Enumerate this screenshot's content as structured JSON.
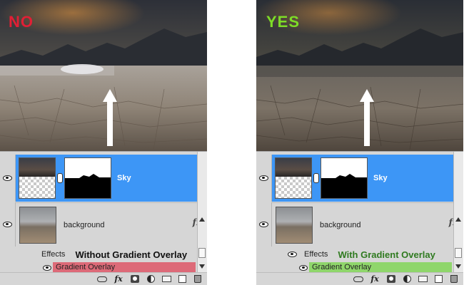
{
  "panels": [
    {
      "verdict": "NO",
      "layers": {
        "sky_layer": "Sky",
        "background_layer": "background",
        "effects_label": "Effects",
        "annotation": "Without Gradient Overlay",
        "effect_item": "Gradient Overlay",
        "fx_badge": "fx"
      },
      "effect_bar_color": "#dd6a78",
      "verdict_color": "#e11f35"
    },
    {
      "verdict": "YES",
      "layers": {
        "sky_layer": "Sky",
        "background_layer": "background",
        "effects_label": "Effects",
        "annotation": "With Gradient Overlay",
        "effect_item": "Gradient Overlay",
        "fx_badge": "fx"
      },
      "effect_bar_color": "#8fd66b",
      "verdict_color": "#7ddc27"
    }
  ],
  "toolbar": {
    "icons": [
      "link-icon",
      "fx-icon",
      "mask-icon",
      "adjustment-icon",
      "folder-icon",
      "new-layer-icon",
      "trash-icon"
    ],
    "fx_label": "fx"
  },
  "colors": {
    "selected_layer": "#3d96f6",
    "panel_bg": "#d6d6d6"
  }
}
